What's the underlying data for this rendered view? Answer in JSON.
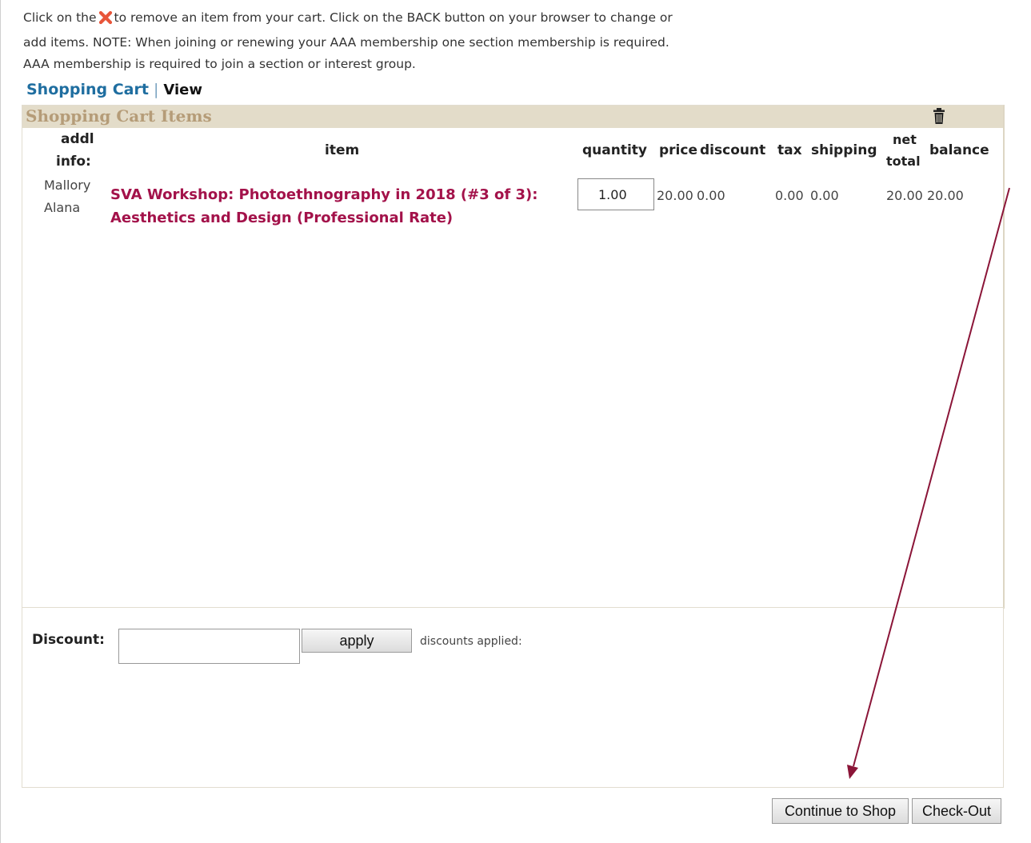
{
  "instructions": {
    "line1_before": "Click on the",
    "line1_after": "to remove an item from your cart. Click on the BACK button on your browser to change or",
    "line2": "add items. NOTE: When joining or renewing your AAA membership one section membership is required.",
    "line3": "AAA membership is required to join a section or interest group.",
    "remove_icon": "red-x-icon"
  },
  "breadcrumb": {
    "link": "Shopping Cart",
    "separator": "|",
    "current": "View"
  },
  "cart": {
    "title": "Shopping Cart Items",
    "header_icon": "trash-icon",
    "columns": {
      "addl_1": "addl",
      "addl_2": "info:",
      "item": "item",
      "quantity": "quantity",
      "price": "price",
      "discount": "discount",
      "tax": "tax",
      "shipping": "shipping",
      "net_1": "net",
      "net_2": "total",
      "balance": "balance"
    },
    "rows": [
      {
        "addl_info_1": "Mallory",
        "addl_info_2": "Alana",
        "item_line1": "SVA Workshop: Photoethnography in 2018 (#3 of 3):",
        "item_line2": "Aesthetics and Design (Professional Rate)",
        "quantity": "1.00",
        "price": "20.00",
        "discount": "0.00",
        "tax": "0.00",
        "shipping": "0.00",
        "net_total": "20.00",
        "balance": "20.00"
      }
    ]
  },
  "discount": {
    "label": "Discount:",
    "value": "",
    "apply_label": "apply",
    "applied_label": "discounts applied:"
  },
  "actions": {
    "continue_label": "Continue to Shop",
    "checkout_label": "Check-Out"
  },
  "colors": {
    "item_link": "#a3124a",
    "cart_header_bg": "#e3dcc9",
    "cart_header_text": "#b59c78",
    "annotation_arrow": "#8b1538",
    "link_blue": "#1f6ea0"
  }
}
